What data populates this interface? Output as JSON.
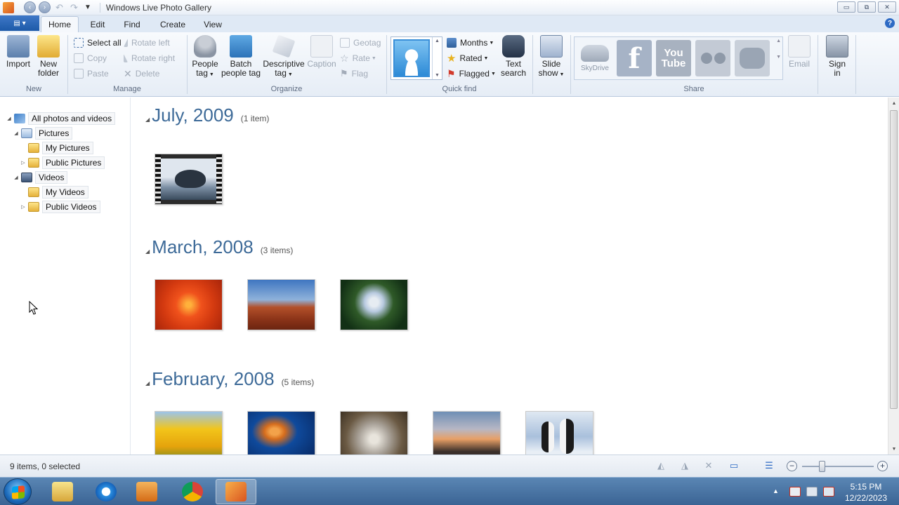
{
  "window": {
    "title": "Windows Live Photo Gallery",
    "minimize": "▭",
    "restore": "⧉",
    "close": "✕"
  },
  "tabs": [
    "Home",
    "Edit",
    "Find",
    "Create",
    "View"
  ],
  "ribbon": {
    "groups": {
      "new": "New",
      "manage": "Manage",
      "organize": "Organize",
      "quick_find": "Quick find",
      "share": "Share"
    },
    "import": "Import",
    "new_folder": [
      "New",
      "folder"
    ],
    "select_all": "Select all",
    "copy": "Copy",
    "paste": "Paste",
    "rotate_left": "Rotate left",
    "rotate_right": "Rotate right",
    "delete": "Delete",
    "people_tag": [
      "People",
      "tag"
    ],
    "batch_people_tag": [
      "Batch",
      "people tag"
    ],
    "descriptive_tag": [
      "Descriptive",
      "tag"
    ],
    "caption": "Caption",
    "geotag": "Geotag",
    "rate": "Rate",
    "flag": "Flag",
    "months": "Months",
    "rated": "Rated",
    "flagged": "Flagged",
    "text_search": [
      "Text",
      "search"
    ],
    "slide_show": [
      "Slide",
      "show"
    ],
    "skydrive": "SkyDrive",
    "youtube": "You Tube",
    "email": "Email",
    "sign_in": [
      "Sign",
      "in"
    ]
  },
  "tree": [
    {
      "label": "All photos and videos",
      "icon": "gallery-icon"
    },
    {
      "label": "Pictures",
      "icon": "pictures-library-icon"
    },
    {
      "label": "My Pictures",
      "icon": "folder-icon"
    },
    {
      "label": "Public Pictures",
      "icon": "folder-icon"
    },
    {
      "label": "Videos",
      "icon": "videos-library-icon"
    },
    {
      "label": "My Videos",
      "icon": "folder-icon"
    },
    {
      "label": "Public Videos",
      "icon": "folder-icon"
    }
  ],
  "groups": [
    {
      "name": "July, 2009",
      "count": "(1 item)"
    },
    {
      "name": "March, 2008",
      "count": "(3 items)"
    },
    {
      "name": "February, 2008",
      "count": "(5 items)"
    }
  ],
  "status": {
    "text": "9 items, 0 selected"
  },
  "clock": {
    "time": "5:15 PM",
    "date": "12/22/2023"
  },
  "colors": {
    "accent": "#2d6ac4",
    "heading": "#3d6a98",
    "taskbar": "#3b6494"
  }
}
